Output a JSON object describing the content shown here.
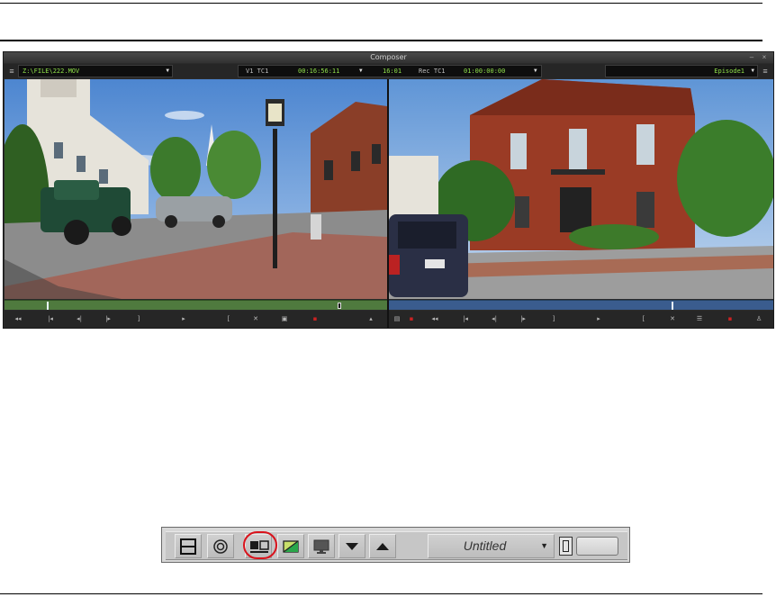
{
  "window": {
    "title": "Composer"
  },
  "source_monitor": {
    "clip_name": "Z:\\FILE\\222.MOV",
    "timecode_label": "V1 TC1",
    "timecode_value": "00:16:56:11"
  },
  "record_monitor": {
    "duration_value": "16:01",
    "timecode_label": "Rec TC1",
    "timecode_value": "01:00:00:00",
    "sequence_name": "Episode1"
  },
  "toolbar": {
    "bin_title": "Untitled",
    "buttons": [
      "single-monitor-icon",
      "effect-mode-icon",
      "source-record-mode-icon",
      "color-correction-icon",
      "full-screen-monitor-icon",
      "collapse-down-icon",
      "expand-up-icon"
    ],
    "highlight_color": "#d9131c"
  },
  "colors": {
    "timecode_text": "#8fe04a",
    "source_timeline": "#4f7a3e",
    "record_timeline": "#3a5c8e"
  }
}
